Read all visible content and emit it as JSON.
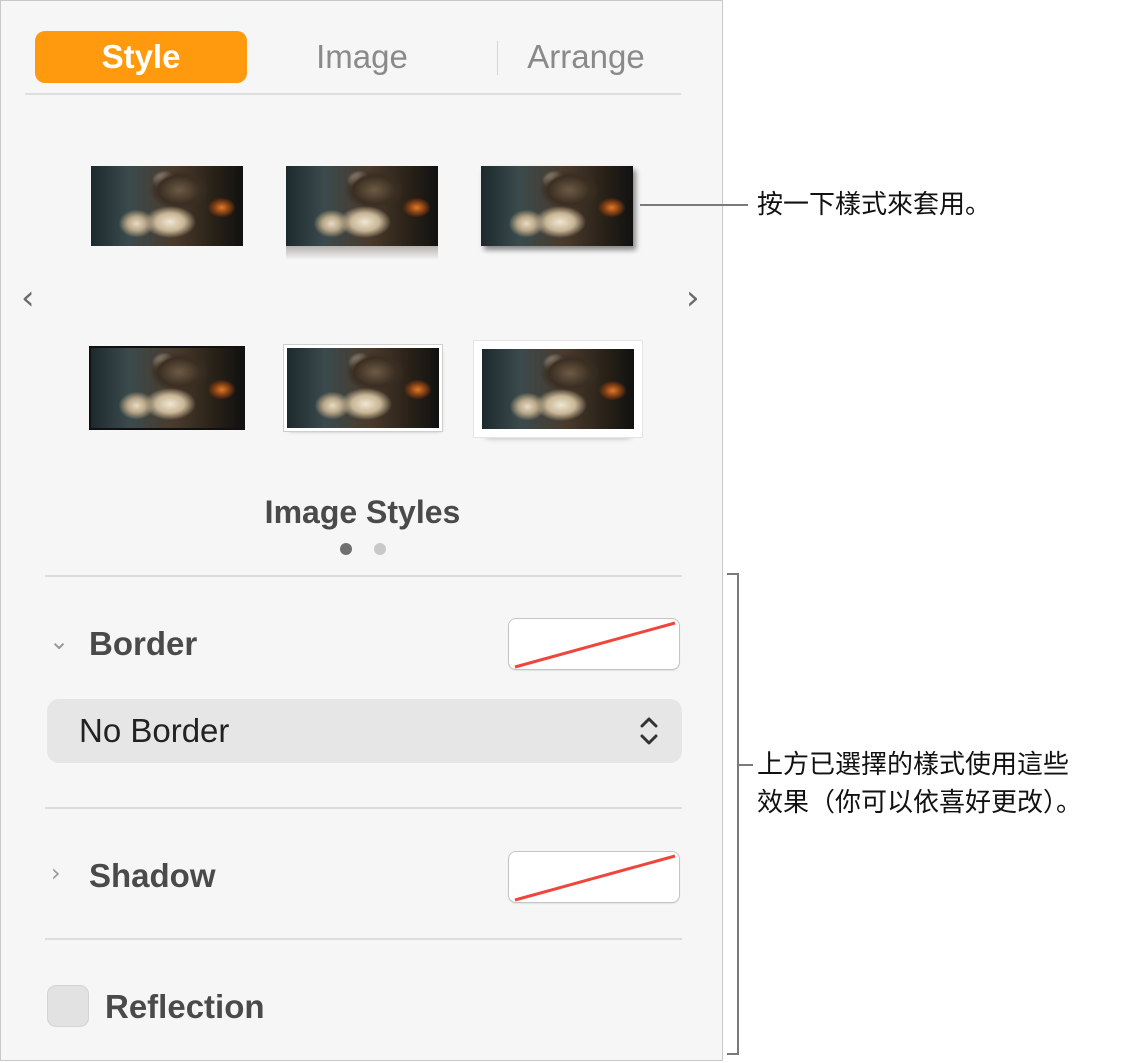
{
  "tabs": [
    {
      "label": "Style",
      "active": true
    },
    {
      "label": "Image",
      "active": false
    },
    {
      "label": "Arrange",
      "active": false
    }
  ],
  "styles": {
    "title": "Image Styles",
    "page": 1,
    "page_count": 2,
    "prev_icon": "chevron-left-icon",
    "next_icon": "chevron-right-icon"
  },
  "border": {
    "label": "Border",
    "expanded": true,
    "popup_value": "No Border"
  },
  "shadow": {
    "label": "Shadow",
    "expanded": false
  },
  "reflection": {
    "label": "Reflection",
    "checked": false
  },
  "colors": {
    "accent": "#ff9a0f",
    "no_fill_slash": "#f0453a"
  },
  "callouts": {
    "styles_hint": "按一下樣式來套用。",
    "effects_hint_line1": "上方已選擇的樣式使用這些",
    "effects_hint_line2": "效果（你可以依喜好更改）。"
  }
}
